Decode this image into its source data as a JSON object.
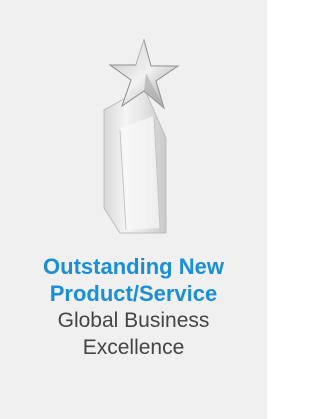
{
  "award": {
    "title_line1": "Outstanding New",
    "title_line2": "Product/Service",
    "org_line1": "Global Business",
    "org_line2": "Excellence",
    "title_color": "#1b8ed8",
    "org_color": "#444444",
    "image_icon": "star-trophy-icon"
  }
}
